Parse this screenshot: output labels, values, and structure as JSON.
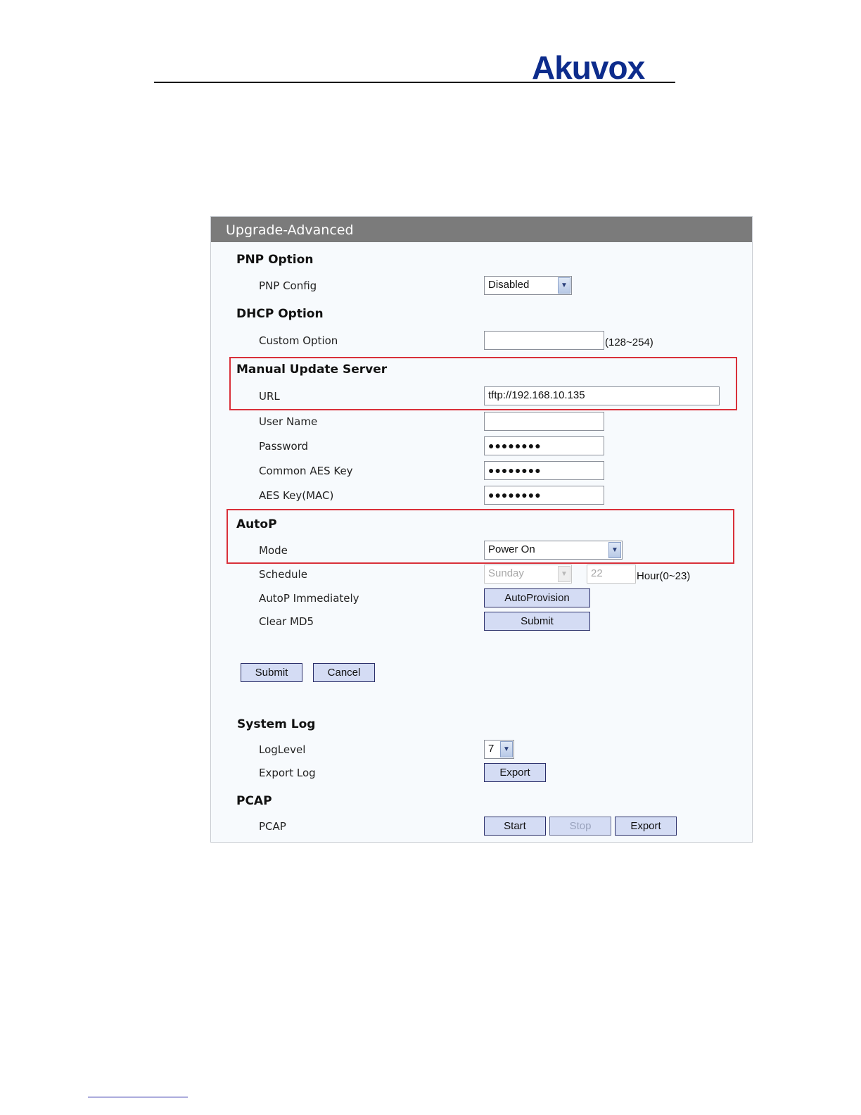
{
  "header": {
    "logo": "Akuvox"
  },
  "panel": {
    "title": "Upgrade-Advanced",
    "pnp": {
      "heading": "PNP Option",
      "config_label": "PNP Config",
      "config_value": "Disabled"
    },
    "dhcp": {
      "heading": "DHCP Option",
      "custom_label": "Custom Option",
      "custom_value": "",
      "custom_hint": "(128~254)"
    },
    "manual": {
      "heading": "Manual Update Server",
      "url_label": "URL",
      "url_value": "tftp://192.168.10.135",
      "user_label": "User Name",
      "user_value": "",
      "password_label": "Password",
      "password_value": "●●●●●●●●",
      "aes_label": "Common AES Key",
      "aes_value": "●●●●●●●●",
      "aes_mac_label": "AES Key(MAC)",
      "aes_mac_value": "●●●●●●●●"
    },
    "autop": {
      "heading": "AutoP",
      "mode_label": "Mode",
      "mode_value": "Power On",
      "schedule_label": "Schedule",
      "schedule_day": "Sunday",
      "schedule_hour": "22",
      "schedule_hint": "Hour(0~23)",
      "immediately_label": "AutoP Immediately",
      "immediately_button": "AutoProvision",
      "clear_md5_label": "Clear MD5",
      "clear_md5_button": "Submit"
    },
    "actions": {
      "submit": "Submit",
      "cancel": "Cancel"
    },
    "syslog": {
      "heading": "System Log",
      "level_label": "LogLevel",
      "level_value": "7",
      "export_label": "Export Log",
      "export_button": "Export"
    },
    "pcap": {
      "heading": "PCAP",
      "label": "PCAP",
      "start": "Start",
      "stop": "Stop",
      "export": "Export"
    }
  },
  "colors": {
    "brand": "#0d2c8c",
    "highlight": "#d9303a",
    "title_bar": "#7b7b7b",
    "button": "#d4dcf4"
  }
}
